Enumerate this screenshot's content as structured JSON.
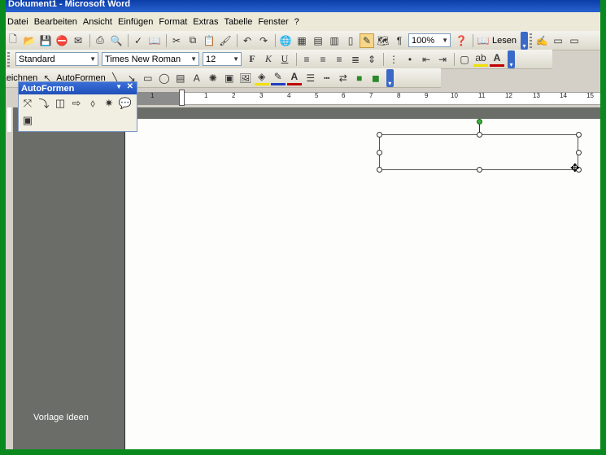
{
  "window": {
    "title": "Dokument1 - Microsoft Word"
  },
  "menu": [
    "Datei",
    "Bearbeiten",
    "Ansicht",
    "Einfügen",
    "Format",
    "Extras",
    "Tabelle",
    "Fenster",
    "?"
  ],
  "standard_toolbar": {
    "zoom": "100%",
    "read_label": "Lesen",
    "icons": [
      "new-icon",
      "open-icon",
      "save-icon",
      "permission-icon",
      "email-icon",
      "print-icon",
      "print-preview-icon",
      "spelling-icon",
      "research-icon",
      "cut-icon",
      "copy-icon",
      "paste-icon",
      "format-painter-icon",
      "undo-icon",
      "redo-icon",
      "hyperlink-icon",
      "tables-borders-icon",
      "insert-table-icon",
      "insert-excel-icon",
      "columns-icon",
      "drawing-icon",
      "document-map-icon",
      "show-formatting-icon"
    ]
  },
  "formatting_toolbar": {
    "style": "Standard",
    "font": "Times New Roman",
    "size": "12",
    "bold": "F",
    "italic": "K",
    "underline": "U"
  },
  "drawing_toolbar": {
    "draw_label": "Zeichnen",
    "autoshapes_label": "AutoFormen"
  },
  "autoshapes_panel": {
    "title": "AutoFormen",
    "icons": [
      "lines-icon",
      "connectors-icon",
      "basic-shapes-icon",
      "block-arrows-icon",
      "flowchart-icon",
      "stars-banners-icon",
      "callouts-icon",
      "more-autoshapes-icon"
    ]
  },
  "ruler": {
    "ticks": [
      "1",
      "1",
      "2",
      "3",
      "4",
      "5",
      "6",
      "7",
      "8",
      "9",
      "10",
      "11",
      "12",
      "13",
      "14",
      "15"
    ]
  },
  "side_panel": {
    "caption": "Vorlage Ideen"
  },
  "colors": {
    "titlebar": "#1f4fb8",
    "frame": "#0a8a1e",
    "panel_bg": "#6b6d69"
  }
}
